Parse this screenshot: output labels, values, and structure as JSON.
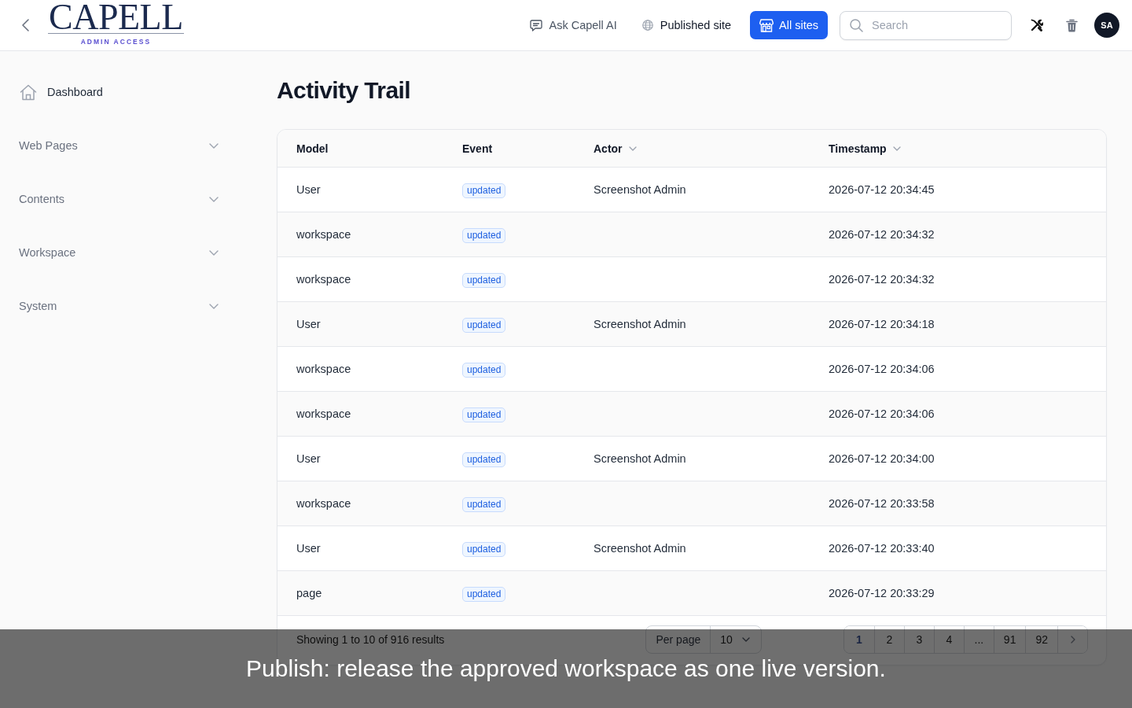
{
  "header": {
    "logo": {
      "name": "CAPELL",
      "tagline": "ADMIN ACCESS"
    },
    "actions": [
      {
        "label": "Ask Capell AI",
        "kind": "quiet"
      },
      {
        "label": "Published site",
        "kind": "link"
      },
      {
        "label": "All sites",
        "kind": "primary"
      }
    ],
    "search": {
      "placeholder": "Search"
    },
    "avatar": "SA"
  },
  "sidebar": {
    "items": [
      {
        "label": "Dashboard",
        "kind": "link"
      },
      {
        "label": "Web Pages",
        "kind": "group",
        "expanded": false
      },
      {
        "label": "Contents",
        "kind": "group",
        "expanded": false
      },
      {
        "label": "Workspace",
        "kind": "group",
        "expanded": false
      },
      {
        "label": "System",
        "kind": "group",
        "expanded": false
      }
    ]
  },
  "page": {
    "title": "Activity Trail"
  },
  "table": {
    "columns": [
      {
        "label": "Model",
        "sortable": false
      },
      {
        "label": "Event",
        "sortable": false
      },
      {
        "label": "Actor",
        "sortable": true
      },
      {
        "label": "Timestamp",
        "sortable": true
      }
    ],
    "rows": [
      {
        "model": "User",
        "event": "updated",
        "actor": "Screenshot Admin",
        "timestamp": "2026-07-12 20:34:45"
      },
      {
        "model": "workspace",
        "event": "updated",
        "timestamp": "2026-07-12 20:34:32"
      },
      {
        "model": "workspace",
        "event": "updated",
        "timestamp": "2026-07-12 20:34:32"
      },
      {
        "model": "User",
        "event": "updated",
        "actor": "Screenshot Admin",
        "timestamp": "2026-07-12 20:34:18"
      },
      {
        "model": "workspace",
        "event": "updated",
        "timestamp": "2026-07-12 20:34:06"
      },
      {
        "model": "workspace",
        "event": "updated",
        "timestamp": "2026-07-12 20:34:06"
      },
      {
        "model": "User",
        "event": "updated",
        "actor": "Screenshot Admin",
        "timestamp": "2026-07-12 20:34:00"
      },
      {
        "model": "workspace",
        "event": "updated",
        "timestamp": "2026-07-12 20:33:58"
      },
      {
        "model": "User",
        "event": "updated",
        "actor": "Screenshot Admin",
        "timestamp": "2026-07-12 20:33:40"
      },
      {
        "model": "page",
        "event": "updated",
        "timestamp": "2026-07-12 20:33:29"
      }
    ]
  },
  "pagination": {
    "summary": "Showing 1 to 10 of 916 results",
    "per_page": {
      "label": "Per page",
      "value": "10"
    },
    "pages": [
      {
        "label": "1",
        "selected": true
      },
      {
        "label": "2",
        "selected": false
      },
      {
        "label": "3",
        "selected": false
      },
      {
        "label": "4",
        "selected": false
      },
      {
        "label": "...",
        "selected": false
      },
      {
        "label": "91",
        "selected": false
      },
      {
        "label": "92",
        "selected": false
      }
    ]
  },
  "caption": {
    "text": "Publish: release the approved workspace as one live version."
  }
}
